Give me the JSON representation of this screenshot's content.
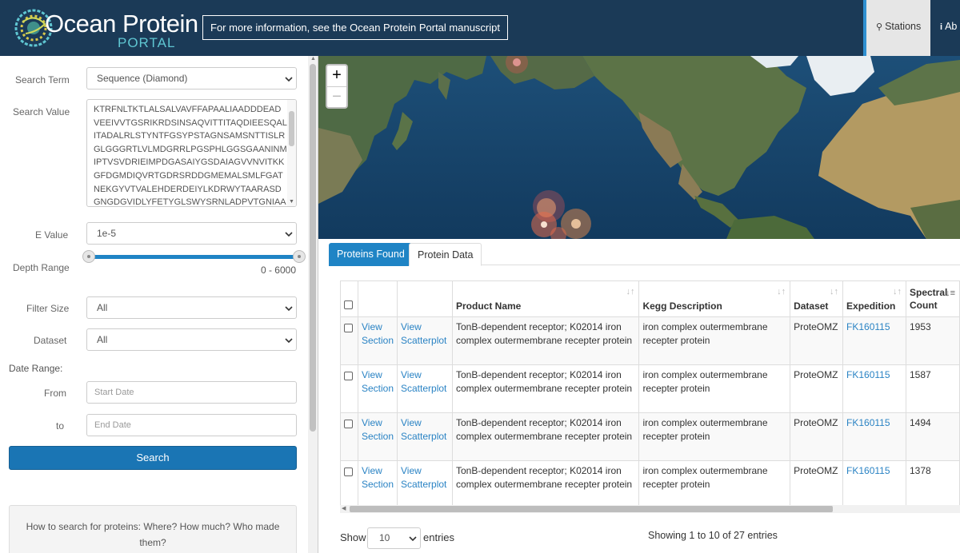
{
  "header": {
    "logo_title": "Ocean Protein",
    "logo_sub": "PORTAL",
    "info_link": "For more information, see the Ocean Protein Portal manuscript",
    "nav": [
      {
        "label": "Stations",
        "icon": "map-marker-icon"
      },
      {
        "label": "Ab",
        "icon": "info-icon"
      }
    ]
  },
  "sidebar": {
    "search_term_label": "Search Term",
    "search_term_value": "Sequence (Diamond)",
    "search_value_label": "Search Value",
    "sequence": "KTRFNLTKTLALSALVAVFFAPAALIAADDDEAD\nVEEIVVTGSRIKRDSINSAQVITTITAQDIEESQAL\nITADALRLSTYNTFGSYPSTAGNSAMSNTTISLR\nGLGGGRTLVLMDGRRLPGSPHLGGSGAANINM\nIPTVSVDRIEIMPDGASAIYGSDAIAGVVNVITKK\nGFDGMDIQVRTGDRSRDDGMEMALSMLFGAT\nNEKGYVTVALEHDERDEIYLKDRWYTAARASD\nGNGDGVIDLYFETYGLSWYSRNLADPVTGNIAA",
    "evalue_label": "E Value",
    "evalue_value": "1e-5",
    "depth_label": "Depth Range",
    "depth_value": "0 - 6000",
    "filter_size_label": "Filter Size",
    "filter_size_value": "All",
    "dataset_label": "Dataset",
    "dataset_value": "All",
    "date_range_label": "Date Range:",
    "from_label": "From",
    "from_placeholder": "Start Date",
    "to_label": "to",
    "to_placeholder": "End Date",
    "search_button": "Search",
    "help_text": "How to search for proteins: Where? How much? Who made them?"
  },
  "map": {
    "zoom_in": "+",
    "zoom_out": "−"
  },
  "panel": {
    "tabs": [
      {
        "label": "Proteins Found",
        "active": true
      },
      {
        "label": "Protein Data",
        "active": false
      }
    ],
    "columns": [
      "",
      "",
      "",
      "Product Name",
      "Kegg Description",
      "Dataset",
      "Expedition",
      "Spectral Count"
    ],
    "rows": [
      {
        "view_section": "View Section",
        "view_scatter": "View Scatterplot",
        "product": "TonB-dependent receptor; K02014 iron complex outermembrane recepter protein",
        "kegg": "iron complex outermembrane recepter protein",
        "dataset": "ProteOMZ",
        "expedition": "FK160115",
        "count": "1953"
      },
      {
        "view_section": "View Section",
        "view_scatter": "View Scatterplot",
        "product": "TonB-dependent receptor; K02014 iron complex outermembrane recepter protein",
        "kegg": "iron complex outermembrane recepter protein",
        "dataset": "ProteOMZ",
        "expedition": "FK160115",
        "count": "1587"
      },
      {
        "view_section": "View Section",
        "view_scatter": "View Scatterplot",
        "product": "TonB-dependent receptor; K02014 iron complex outermembrane recepter protein",
        "kegg": "iron complex outermembrane recepter protein",
        "dataset": "ProteOMZ",
        "expedition": "FK160115",
        "count": "1494"
      },
      {
        "view_section": "View Section",
        "view_scatter": "View Scatterplot",
        "product": "TonB-dependent receptor; K02014 iron complex outermembrane recepter protein",
        "kegg": "iron complex outermembrane recepter protein",
        "dataset": "ProteOMZ",
        "expedition": "FK160115",
        "count": "1378"
      }
    ],
    "show_label": "Show",
    "page_length": "10",
    "entries_label": "entries",
    "info": "Showing 1 to 10 of 27 entries"
  },
  "colors": {
    "header_bg": "#1b3a57",
    "accent": "#1f84c5",
    "link": "#2a83c4"
  }
}
